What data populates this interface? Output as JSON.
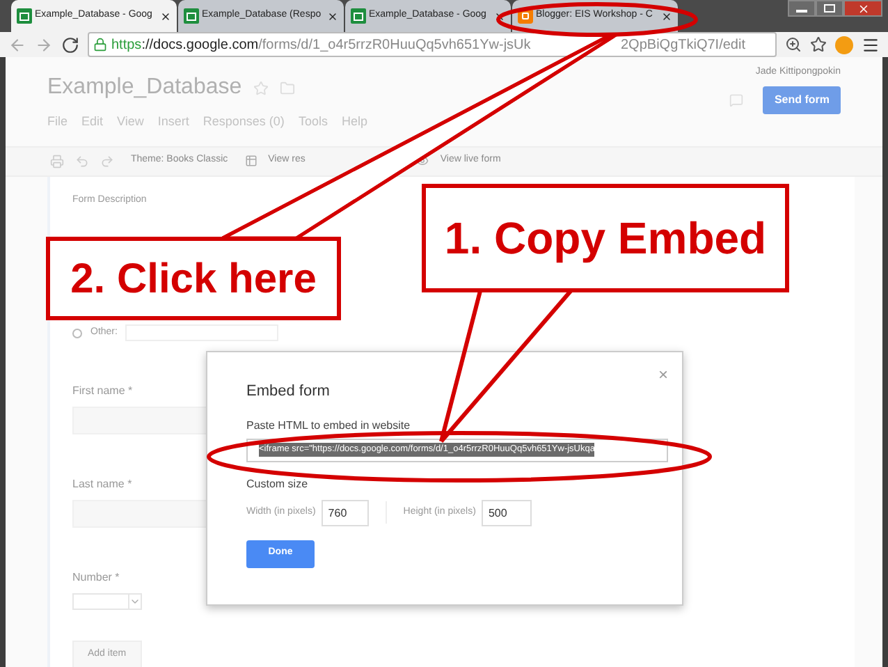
{
  "tabs": [
    {
      "kind": "sheets",
      "label": "Example_Database - Goog",
      "selected": true
    },
    {
      "kind": "sheets",
      "label": "Example_Database (Respo",
      "selected": false
    },
    {
      "kind": "sheets",
      "label": "Example_Database - Goog",
      "selected": false
    },
    {
      "kind": "blogger",
      "label": "Blogger: EIS Workshop - C",
      "selected": false
    }
  ],
  "address_bar": {
    "scheme": "https",
    "host": "://docs.google.com",
    "path": "/forms/d/1_o4r5rrzR0HuuQq5vh651Yw-jsUk",
    "path_after_pointer": "2QpBiQgTkiQ7I/edit"
  },
  "header": {
    "title": "Example_Database",
    "user": "Jade Kittipongpokin",
    "send_button": "Send form",
    "menu": [
      "File",
      "Edit",
      "View",
      "Insert",
      "Responses (0)",
      "Tools",
      "Help"
    ]
  },
  "toolbar": {
    "theme": "Theme: Books Classic",
    "view_responses": "View res",
    "view_live": "View live form"
  },
  "form": {
    "description": "Form Description",
    "other_option": "Other:",
    "other_selected": false,
    "fields": [
      {
        "kind": "text",
        "label": "First name *"
      },
      {
        "kind": "text",
        "label": "Last name *"
      },
      {
        "kind": "dropdown",
        "label": "Number *"
      }
    ],
    "add_item": "Add item"
  },
  "dialog": {
    "title": "Embed form",
    "close": "×",
    "paste_label": "Paste HTML to embed in website",
    "code": "<iframe src=\"https://docs.google.com/forms/d/1_o4r5rrzR0HuuQq5vh651Yw-jsUkqa",
    "code_selected": true,
    "custom_size": "Custom size",
    "width_label": "Width (in pixels)",
    "width_value": "760",
    "height_label": "Height (in pixels)",
    "height_value": "500",
    "done": "Done"
  },
  "callouts": [
    {
      "text": "1. Copy Embed"
    },
    {
      "text": "2. Click here"
    }
  ]
}
